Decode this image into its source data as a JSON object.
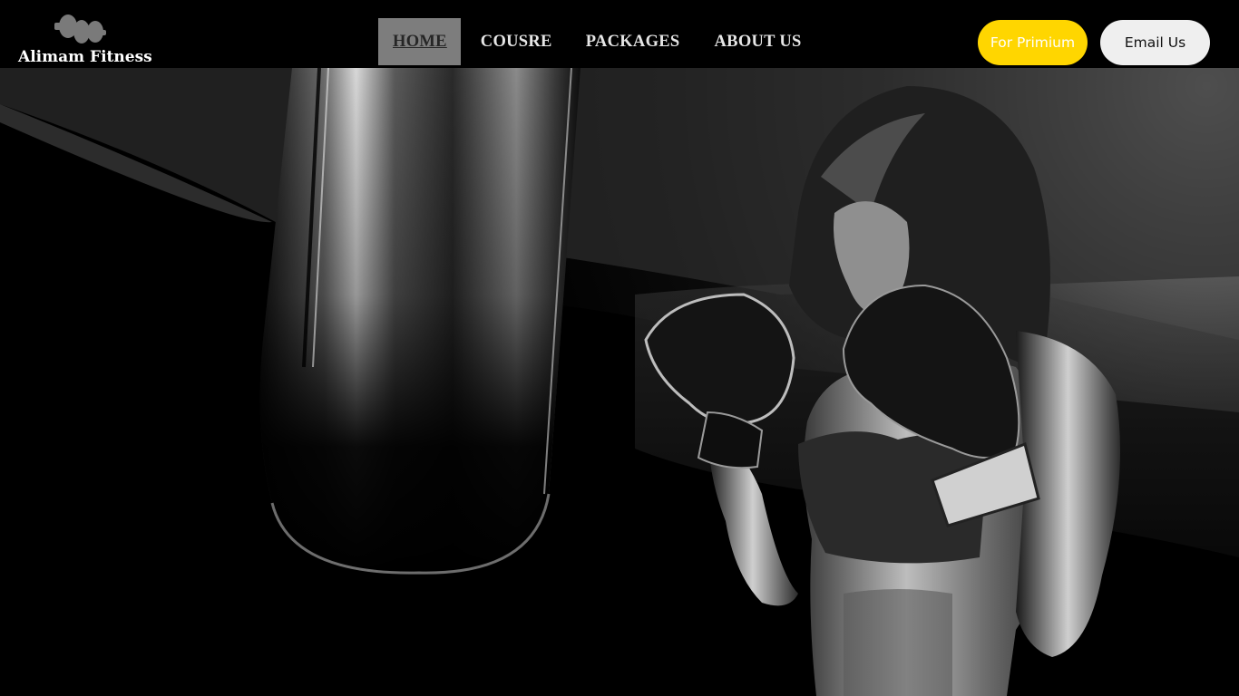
{
  "brand": {
    "name": "Alimam Fitness",
    "logo_icon": "dumbbell-icon",
    "logo_color": "#7a7a7a"
  },
  "nav": {
    "items": [
      {
        "label": "HOME",
        "active": true
      },
      {
        "label": "COUSRE",
        "active": false
      },
      {
        "label": "PACKAGES",
        "active": false
      },
      {
        "label": "ABOUT US",
        "active": false
      }
    ]
  },
  "actions": {
    "premium_label": "For Primium",
    "email_label": "Email Us"
  },
  "colors": {
    "background": "#000000",
    "nav_active_bg": "#7d7d7d",
    "premium_button": "#ffd600",
    "email_button": "#efefef"
  },
  "hero": {
    "image": "boxer-with-punching-bag-illustration"
  }
}
